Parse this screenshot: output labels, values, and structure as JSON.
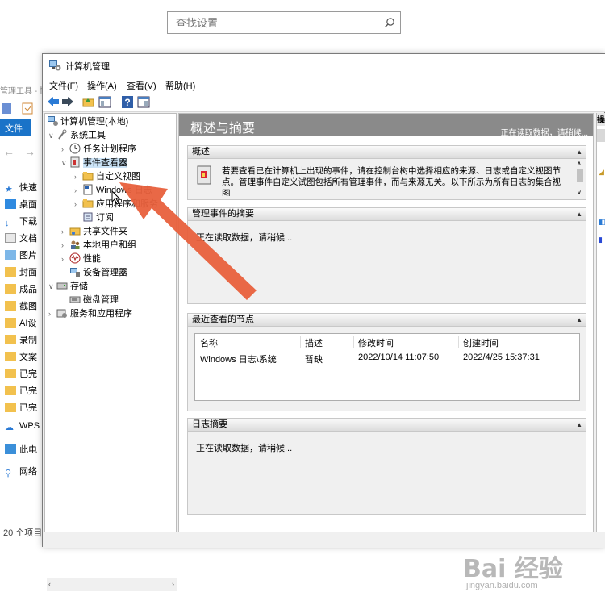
{
  "search": {
    "placeholder": "查找设置"
  },
  "explorer": {
    "title": "管理工具 - 快速访问",
    "file_tab": "文件",
    "items": [
      "快速",
      "桌面",
      "下载",
      "文档",
      "图片",
      "封面",
      "成品",
      "截图",
      "AI设",
      "录制",
      "文案",
      "已完",
      "已完",
      "已完",
      "WPS",
      "此电",
      "网络"
    ],
    "status": "20 个项目"
  },
  "window": {
    "title": "计算机管理",
    "menu": [
      "文件(F)",
      "操作(A)",
      "查看(V)",
      "帮助(H)"
    ]
  },
  "tree": {
    "root": "计算机管理(本地)",
    "system_tools": "系统工具",
    "task_scheduler": "任务计划程序",
    "event_viewer": "事件查看器",
    "custom_views": "自定义视图",
    "windows_logs": "Windows 日志",
    "app_service_logs": "应用程序和服务",
    "subscriptions": "订阅",
    "shared_folders": "共享文件夹",
    "local_users": "本地用户和组",
    "performance": "性能",
    "device_manager": "设备管理器",
    "storage": "存储",
    "disk_management": "磁盘管理",
    "services_apps": "服务和应用程序"
  },
  "center": {
    "header_title": "概述与摘要",
    "header_status": "正在读取数据，请稍候...",
    "overview": {
      "title": "概述",
      "text_line1": "若要查看已在计算机上出现的事件，请在控制台树中选择相应的来源、日志或自定义视图节",
      "text_line2": "点。管理事件自定义试图包括所有管理事件，而与来源无关。以下所示为所有日志的集合视",
      "text_line3": "图"
    },
    "admin_summary": {
      "title": "管理事件的摘要",
      "text": "正在读取数据，请稍候..."
    },
    "recent": {
      "title": "最近查看的节点",
      "columns": [
        "名称",
        "描述",
        "修改时间",
        "创建时间"
      ],
      "rows": [
        [
          "Windows 日志\\系统",
          "暂缺",
          "2022/10/14 11:07:50",
          "2022/4/25 15:37:31"
        ]
      ]
    },
    "log_summary": {
      "title": "日志摘要",
      "text": "正在读取数据，请稍候..."
    }
  },
  "actions": {
    "label": "操"
  },
  "watermark": {
    "brand": "Bai 经验",
    "url": "jingyan.baidu.com"
  },
  "colors": {
    "accent": "#1a73c8",
    "arrow": "#e8603c",
    "header_gray": "#8a8a8a",
    "selection": "#cce4f7"
  }
}
